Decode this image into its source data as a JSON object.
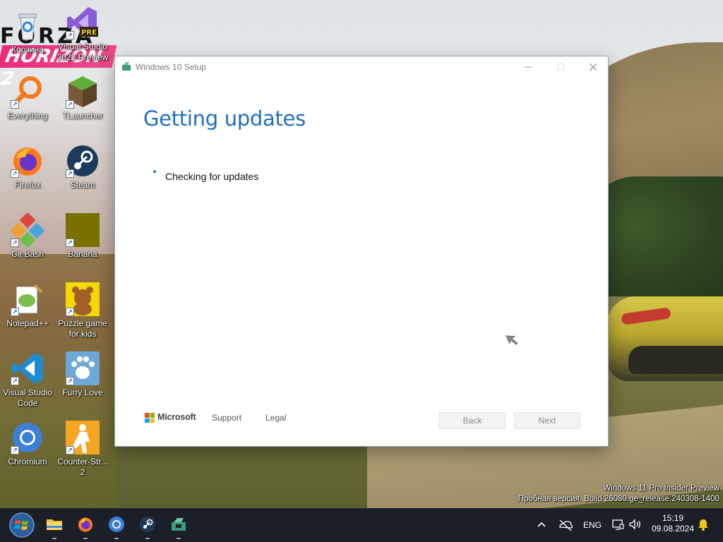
{
  "wallpaper": {
    "logo_top": "FORZA",
    "logo_bottom": "HORIZON 2"
  },
  "desktop_icons": [
    {
      "label": "Корзина",
      "icon": "recycle-bin-icon"
    },
    {
      "label": "Visual Studio 2022 Preview",
      "icon": "visual-studio-preview-icon",
      "badge": "PRE"
    },
    {
      "label": "Everything",
      "icon": "everything-search-icon"
    },
    {
      "label": "TLauncher",
      "icon": "tlauncher-icon"
    },
    {
      "label": "Firefox",
      "icon": "firefox-icon"
    },
    {
      "label": "Steam",
      "icon": "steam-icon"
    },
    {
      "label": "Git Bash",
      "icon": "git-bash-icon"
    },
    {
      "label": "Banana",
      "icon": "banana-icon"
    },
    {
      "label": "Notepad++",
      "icon": "notepadpp-icon"
    },
    {
      "label": "Puzzle game for kids",
      "icon": "puzzle-game-icon"
    },
    {
      "label": "Visual Studio Code",
      "icon": "vscode-icon"
    },
    {
      "label": "Furry Love",
      "icon": "furry-love-icon"
    },
    {
      "label": "Chromium",
      "icon": "chromium-icon"
    },
    {
      "label": "Counter-Str... 2",
      "icon": "counter-strike-icon"
    }
  ],
  "setup_window": {
    "title": "Windows 10 Setup",
    "heading": "Getting updates",
    "status": "Checking for updates",
    "footer": {
      "brand": "Microsoft",
      "support_link": "Support",
      "legal_link": "Legal",
      "back_button": "Back",
      "next_button": "Next"
    }
  },
  "watermark": {
    "line1": "Windows 11 Pro Insider Preview",
    "line2": "Пробная версия. Build 26080.ge_release.240308-1400"
  },
  "taskbar": {
    "pinned": [
      {
        "name": "file-explorer",
        "icon": "folder-icon",
        "running": true
      },
      {
        "name": "firefox",
        "icon": "firefox-icon",
        "running": true
      },
      {
        "name": "chromium",
        "icon": "chromium-icon",
        "running": true
      },
      {
        "name": "steam",
        "icon": "steam-icon",
        "running": true
      },
      {
        "name": "windows-setup",
        "icon": "windows-setup-icon",
        "running": true
      }
    ],
    "tray": {
      "language": "ENG",
      "time": "15:19",
      "date": "09.08.2024"
    }
  },
  "colors": {
    "heading_blue": "#1f6fbf",
    "taskbar": "#1b1f27",
    "ms_red": "#f25022",
    "ms_green": "#7fba00",
    "ms_blue": "#00a4ef",
    "ms_yellow": "#ffb900"
  }
}
